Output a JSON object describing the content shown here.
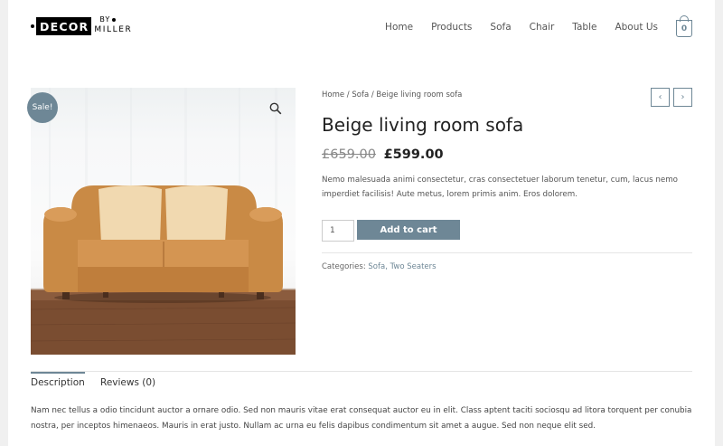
{
  "header": {
    "logo": {
      "main": "DECOR",
      "by": "BY",
      "sub": "MILLER"
    },
    "nav": [
      "Home",
      "Products",
      "Sofa",
      "Chair",
      "Table",
      "About Us"
    ],
    "cart_count": "0"
  },
  "product": {
    "sale_badge": "Sale!",
    "breadcrumb": "Home / Sofa / Beige living room sofa",
    "title": "Beige living room sofa",
    "old_price": "£659.00",
    "new_price": "£599.00",
    "short_description": "Nemo malesuada animi consectetur, cras consectetuer laborum tenetur, cum, lacus nemo imperdiet facilisis! Aute metus, lorem primis anim. Eros dolorem.",
    "quantity": "1",
    "add_to_cart_label": "Add to cart",
    "categories_label": "Categories:",
    "categories": "Sofa, Two Seaters"
  },
  "tabs": {
    "items": [
      "Description",
      "Reviews (0)"
    ],
    "active": "Description",
    "description_text": "Nam nec tellus a odio tincidunt auctor a ornare odio. Sed non mauris vitae erat consequat auctor eu in elit. Class aptent taciti sociosqu ad litora torquent per conubia nostra, per inceptos himenaeos. Mauris in erat justo. Nullam ac urna eu felis dapibus condimentum sit amet a augue. Sed non neque elit sed."
  },
  "colors": {
    "accent": "#6e8796",
    "sofa": "#c98a45"
  },
  "icons": [
    "zoom-icon",
    "cart-icon",
    "prev-arrow-icon",
    "next-arrow-icon"
  ]
}
